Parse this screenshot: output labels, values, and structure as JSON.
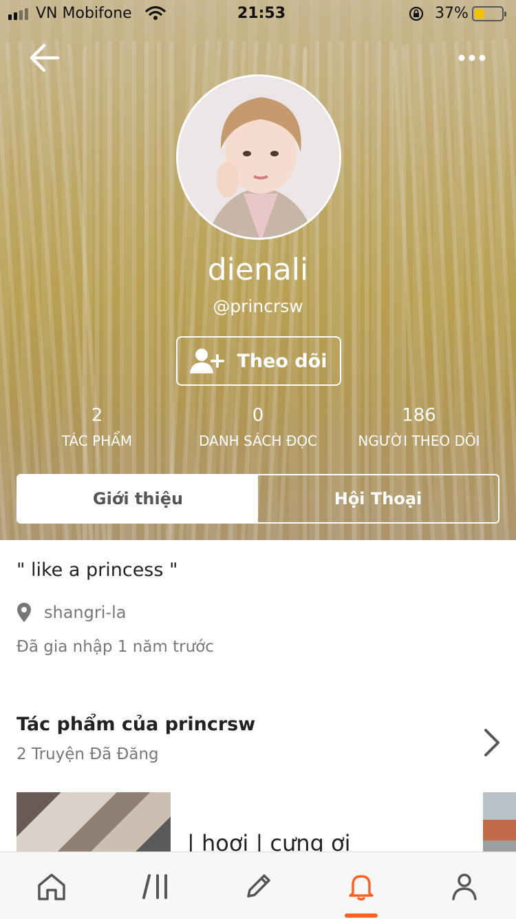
{
  "status_bar": {
    "carrier": "VN Mobifone",
    "time": "21:53",
    "battery_percent": "37%",
    "battery_level": 0.37,
    "battery_color": "#f2c200"
  },
  "header": {
    "back_icon": "arrow-left-icon",
    "more_icon": "more-horizontal-icon"
  },
  "profile": {
    "display_name": "dienali",
    "username": "@princrsw",
    "follow_label": "Theo dõi",
    "follow_icon": "person-add-icon"
  },
  "stats": [
    {
      "value": "2",
      "label": "TÁC PHẨM"
    },
    {
      "value": "0",
      "label": "DANH SÁCH ĐỌC"
    },
    {
      "value": "186",
      "label": "NGƯỜI THEO DÕI"
    }
  ],
  "tabs": [
    {
      "label": "Giới thiệu",
      "active": true
    },
    {
      "label": "Hội Thoại",
      "active": false
    }
  ],
  "about": {
    "quote": "\" like a princess \"",
    "location": "shangri-la",
    "location_icon": "location-pin-icon",
    "joined": "Đã gia nhập 1 năm trước"
  },
  "works": {
    "title": "Tác phẩm của princrsw",
    "subtitle": "2 Truyện Đã Đăng",
    "first_book_title": "| hoơi | cựng ơi"
  },
  "bottom_nav": {
    "items": [
      "home-icon",
      "library-icon",
      "write-icon",
      "notifications-icon",
      "profile-icon"
    ],
    "active_index": 3,
    "accent_color": "#ff6122"
  }
}
